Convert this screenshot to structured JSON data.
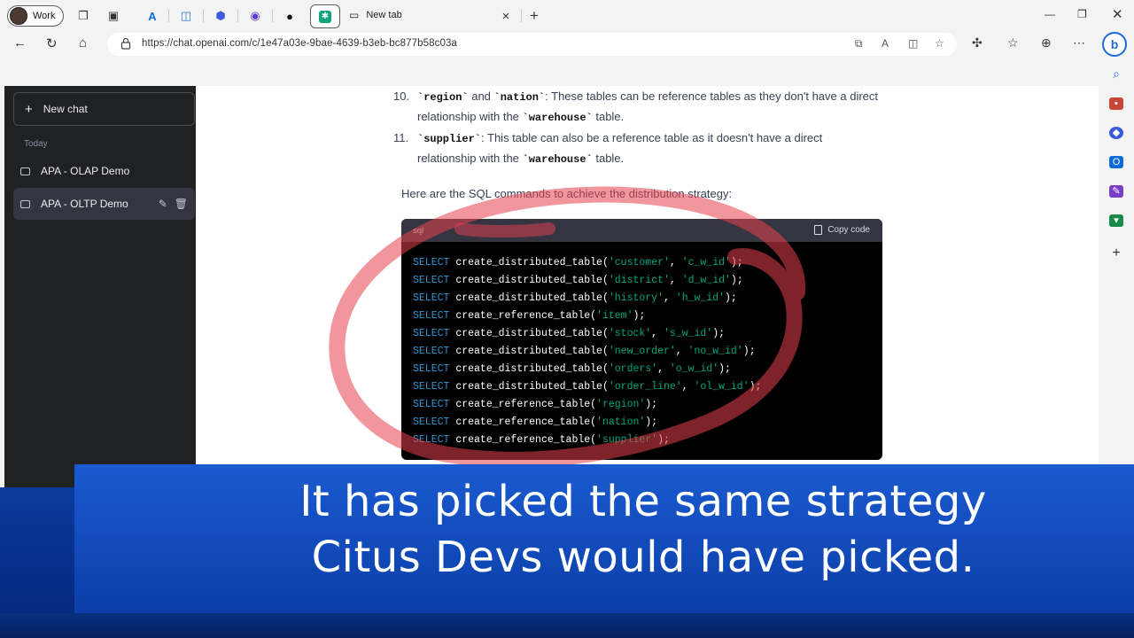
{
  "browser": {
    "profile_label": "Work",
    "new_tab_label": "New tab",
    "url": "https://chat.openai.com/c/1e47a03e-9bae-4639-b3eb-bc877b58c03a"
  },
  "sidebar": {
    "new_chat": "New chat",
    "section": "Today",
    "items": [
      {
        "label": "APA - OLAP Demo"
      },
      {
        "label": "APA - OLTP Demo"
      }
    ]
  },
  "content": {
    "item10_num": "10.",
    "item10_code1": "`region`",
    "item10_and": " and ",
    "item10_code2": "`nation`",
    "item10_text": ": These tables can be reference tables as they don't have a direct",
    "item10_text2a": "relationship with the ",
    "item10_code3": "`warehouse`",
    "item10_text2b": " table.",
    "item11_num": "11.",
    "item11_code1": "`supplier`",
    "item11_text": ": This table can also be a reference table as it doesn't have a direct",
    "item11_text2a": "relationship with the ",
    "item11_code2": "`warehouse`",
    "item11_text2b": " table.",
    "intro": "Here are the SQL commands to achieve the distribution strategy:"
  },
  "code": {
    "lang": "sql",
    "copy_label": "Copy code",
    "lines": [
      {
        "kw": "SELECT",
        "fn": " create_distributed_table(",
        "a": "'customer'",
        "sep": ", ",
        "b": "'c_w_id'",
        "end": ");"
      },
      {
        "kw": "SELECT",
        "fn": " create_distributed_table(",
        "a": "'district'",
        "sep": ", ",
        "b": "'d_w_id'",
        "end": ");"
      },
      {
        "kw": "SELECT",
        "fn": " create_distributed_table(",
        "a": "'history'",
        "sep": ", ",
        "b": "'h_w_id'",
        "end": ");"
      },
      {
        "kw": "SELECT",
        "fn": " create_reference_table(",
        "a": "'item'",
        "sep": "",
        "b": "",
        "end": ");"
      },
      {
        "kw": "SELECT",
        "fn": " create_distributed_table(",
        "a": "'stock'",
        "sep": ", ",
        "b": "'s_w_id'",
        "end": ");"
      },
      {
        "kw": "SELECT",
        "fn": " create_distributed_table(",
        "a": "'new_order'",
        "sep": ", ",
        "b": "'no_w_id'",
        "end": ");"
      },
      {
        "kw": "SELECT",
        "fn": " create_distributed_table(",
        "a": "'orders'",
        "sep": ", ",
        "b": "'o_w_id'",
        "end": ");"
      },
      {
        "kw": "SELECT",
        "fn": " create_distributed_table(",
        "a": "'order_line'",
        "sep": ", ",
        "b": "'ol_w_id'",
        "end": ");"
      },
      {
        "kw": "SELECT",
        "fn": " create_reference_table(",
        "a": "'region'",
        "sep": "",
        "b": "",
        "end": ");"
      },
      {
        "kw": "SELECT",
        "fn": " create_reference_table(",
        "a": "'nation'",
        "sep": "",
        "b": "",
        "end": ");"
      },
      {
        "kw": "SELECT",
        "fn": " create_reference_table(",
        "a": "'supplier'",
        "sep": "",
        "b": "",
        "end": ");"
      }
    ]
  },
  "caption": {
    "line1": "It has picked the same strategy",
    "line2": "Citus Devs would have picked."
  },
  "colors": {
    "accent": "#1a5ad0",
    "annotation": "#e8404f",
    "chatgpt": "#10a37f"
  }
}
